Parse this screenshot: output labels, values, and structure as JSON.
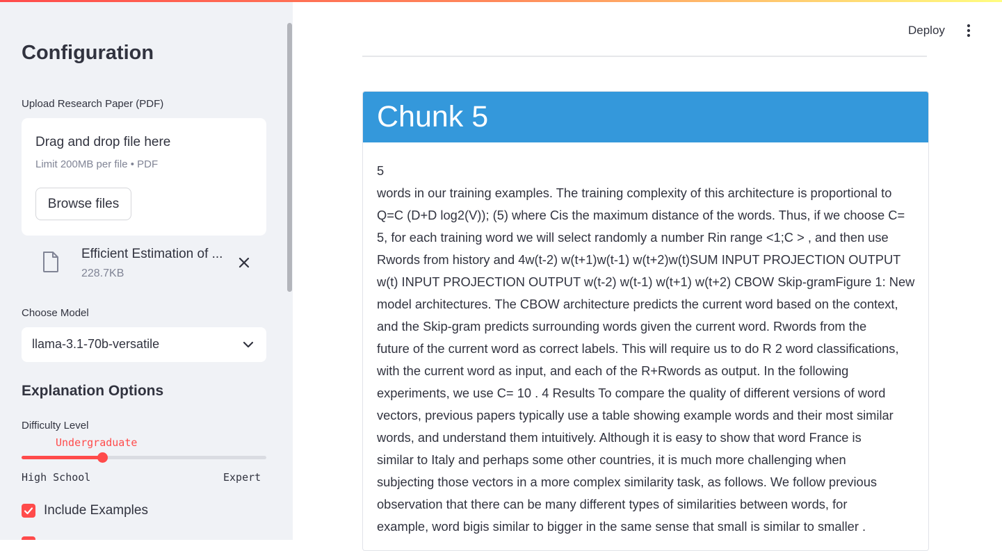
{
  "sidebar": {
    "title": "Configuration",
    "upload": {
      "label": "Upload Research Paper (PDF)",
      "dropzone_title": "Drag and drop file here",
      "limit_text": "Limit 200MB per file • PDF",
      "browse_label": "Browse files",
      "file": {
        "name": "Efficient Estimation of ...",
        "size": "228.7KB",
        "icon": "file-icon"
      }
    },
    "model": {
      "label": "Choose Model",
      "selected": "llama-3.1-70b-versatile"
    },
    "explanation": {
      "title": "Explanation Options",
      "difficulty": {
        "label": "Difficulty Level",
        "value": "Undergraduate",
        "min_label": "High School",
        "max_label": "Expert",
        "position_fraction": 0.33
      },
      "include_examples": {
        "label": "Include Examples",
        "checked": true
      }
    }
  },
  "header": {
    "deploy_label": "Deploy"
  },
  "main": {
    "chunk": {
      "title": "Chunk 5",
      "lines": [
        "5",
        "words in our training examples. The training complexity of this architecture is proportional to",
        "Q=C  (D+D  log2(V)); (5) where Cis the maximum distance of the words. Thus, if we choose C=",
        "5, for each training word we will select randomly a number Rin range <1;C > , and then use",
        "Rwords from history and 4w(t-2) w(t+1)w(t-1) w(t+2)w(t)SUM INPUT PROJECTION OUTPUT",
        "w(t) INPUT PROJECTION OUTPUT w(t-2) w(t-1) w(t+1) w(t+2) CBOW Skip-gramFigure 1: New",
        "model architectures. The CBOW architecture predicts the current word based on the context,",
        "and the Skip-gram predicts surrounding words given the current word. Rwords from the",
        "future of the current word as correct labels. This will require us to do R  2 word classifications,",
        "with the current word as input, and each of the R+Rwords as output. In the following",
        "experiments, we use C= 10 . 4 Results To compare the quality of different versions of word",
        "vectors, previous papers typically use a table showing example words and their most similar",
        "words, and understand them intuitively. Although it is easy to show that word France is",
        "similar to Italy and perhaps some other countries, it is much more challenging when",
        "subjecting those vectors in a more complex similarity task, as follows. We follow previous",
        "observation that there can be many different types of similarities between words, for",
        "example, word bigis similar to bigger in the same sense that small is similar to smaller ."
      ]
    }
  },
  "colors": {
    "accent": "#ff4b4b",
    "chunk_header": "#3498db",
    "sidebar_bg": "#f0f2f6",
    "text": "#31333f",
    "muted": "#808495"
  }
}
